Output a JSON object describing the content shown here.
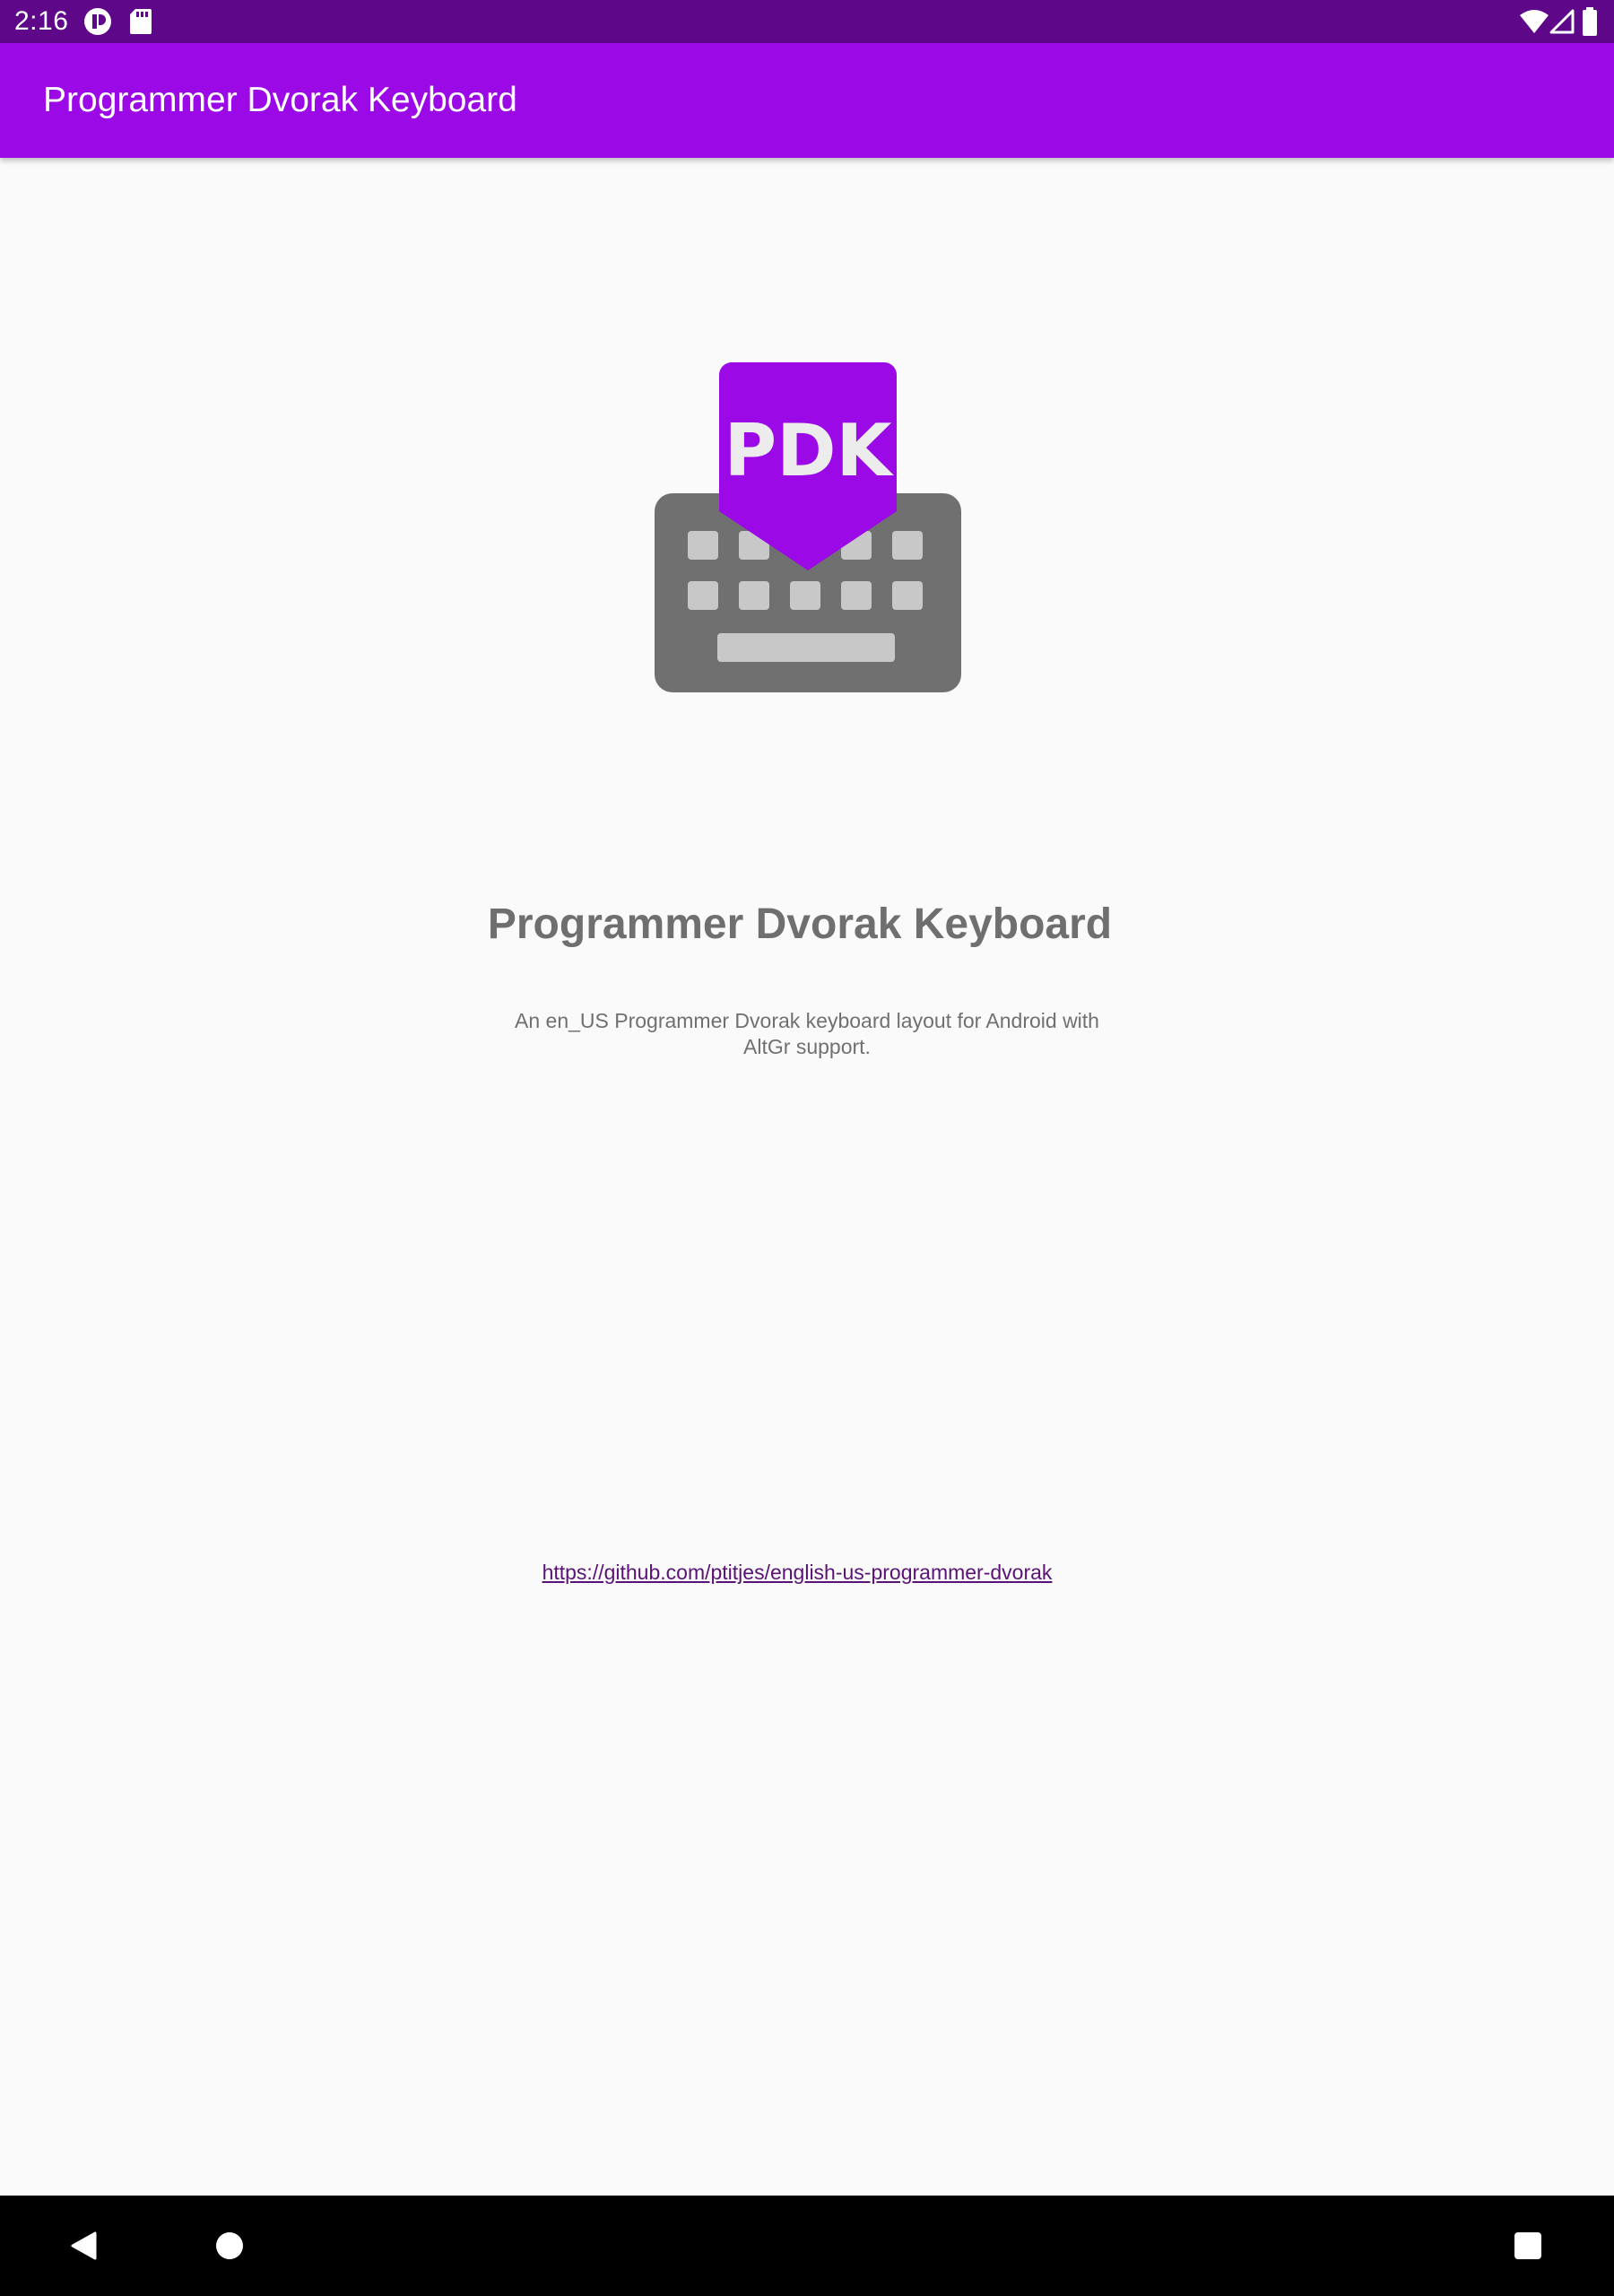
{
  "status_bar": {
    "time": "2:16",
    "left_icons": [
      "ring-badge-icon",
      "sd-card-icon"
    ],
    "right_icons": [
      "wifi-icon",
      "signal-icon",
      "battery-icon"
    ]
  },
  "app_bar": {
    "title": "Programmer Dvorak Keyboard"
  },
  "main": {
    "logo": {
      "text": "PDK",
      "colors": {
        "tag": "#9a09e6",
        "tag_text": "#ececec",
        "keyboard_body": "#707070",
        "keys": "#c8c8c8"
      }
    },
    "heading": "Programmer Dvorak Keyboard",
    "description": "An en_US Programmer Dvorak keyboard layout for Android with AltGr support.",
    "link": "https://github.com/ptitjes/english-us-programmer-dvorak"
  },
  "nav_bar": {
    "buttons": [
      "back-icon",
      "home-icon",
      "recents-icon"
    ]
  },
  "colors": {
    "status_bar": "#5e0788",
    "app_bar": "#9a09e6",
    "background": "#fafafa",
    "text_gray": "#6f6f6f",
    "link": "#5b1277"
  }
}
